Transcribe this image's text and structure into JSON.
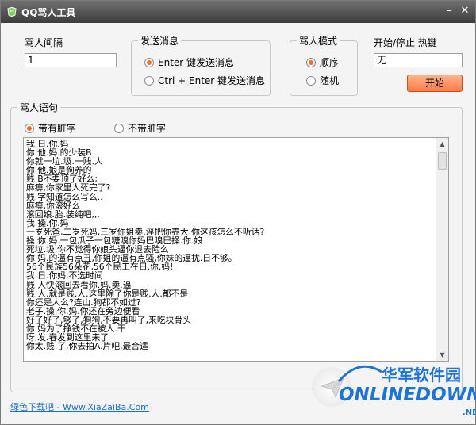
{
  "window": {
    "title": "QQ骂人工具",
    "minimize": "–",
    "close": "✕"
  },
  "interval": {
    "label": "骂人间隔",
    "value": "1"
  },
  "send": {
    "title": "发送消息",
    "options": [
      "Enter 键发送消息",
      "Ctrl + Enter 键发送消息"
    ],
    "selected": 0
  },
  "mode": {
    "title": "骂人模式",
    "options": [
      "顺序",
      "随机"
    ],
    "selected": 0
  },
  "hotkey": {
    "label": "开始/停止 热键",
    "value": "无",
    "start_label": "开始"
  },
  "phrases": {
    "title": "骂人语句",
    "options": [
      "带有脏字",
      "不带脏字"
    ],
    "selected": 0,
    "lines": [
      "我.日.你.妈",
      "你.他.妈.的少装B",
      "你就一垃.圾.一贱.人",
      "你.他.娘是狗养的",
      "贱.B不要顶了好么;",
      "麻痹,你家里人死完了?",
      "贱.字知道怎么写么..",
      "麻痹,你滚好么",
      "滚回娘.胎.装纯吧,,,",
      "我.操.你.妈",
      "一岁死爸,二岁死妈,三岁你姐卖.淫把你养大,你这孩怎么不听话?",
      "操.你.妈.一包瓜子一包糖嗅你妈巴嗅巴操.你.娘",
      "死垃.圾.你不觉得你娘头逼你退去险么",
      "你.妈.的逼有点丑,你姐的逼有点骚,你妹的逼扰.日不够。",
      "56个民族56朵花,56个民工在日.你.妈!",
      "我.日.你妈,不选时间",
      "贱.人快滚回去看你.妈.卖.逼",
      "贱.人.就是贱.人.这里除了你是贱.人.都不是",
      "你还是人么?连山.狗都不如过?",
      "老子.操.你.妈.你还在旁边便看",
      "好了好了,够了,狗狗,不要再叫了,来吃块骨头",
      "你.妈为了挣钱不在被人.干",
      "呀,发.春发到这里来了",
      "你太.贱.了,你去拍A.片吧,最合适"
    ]
  },
  "footer": {
    "link": "绿色下载吧 - Www.XiaZaiBa.Com"
  },
  "watermark": {
    "cn": "华军软件园",
    "en": "ONLINEDOWN",
    "sub": ".NET"
  },
  "colors": {
    "accent": "#ff6a2a",
    "link": "#1a6fd1",
    "titlebar": "#4a4a4a"
  }
}
